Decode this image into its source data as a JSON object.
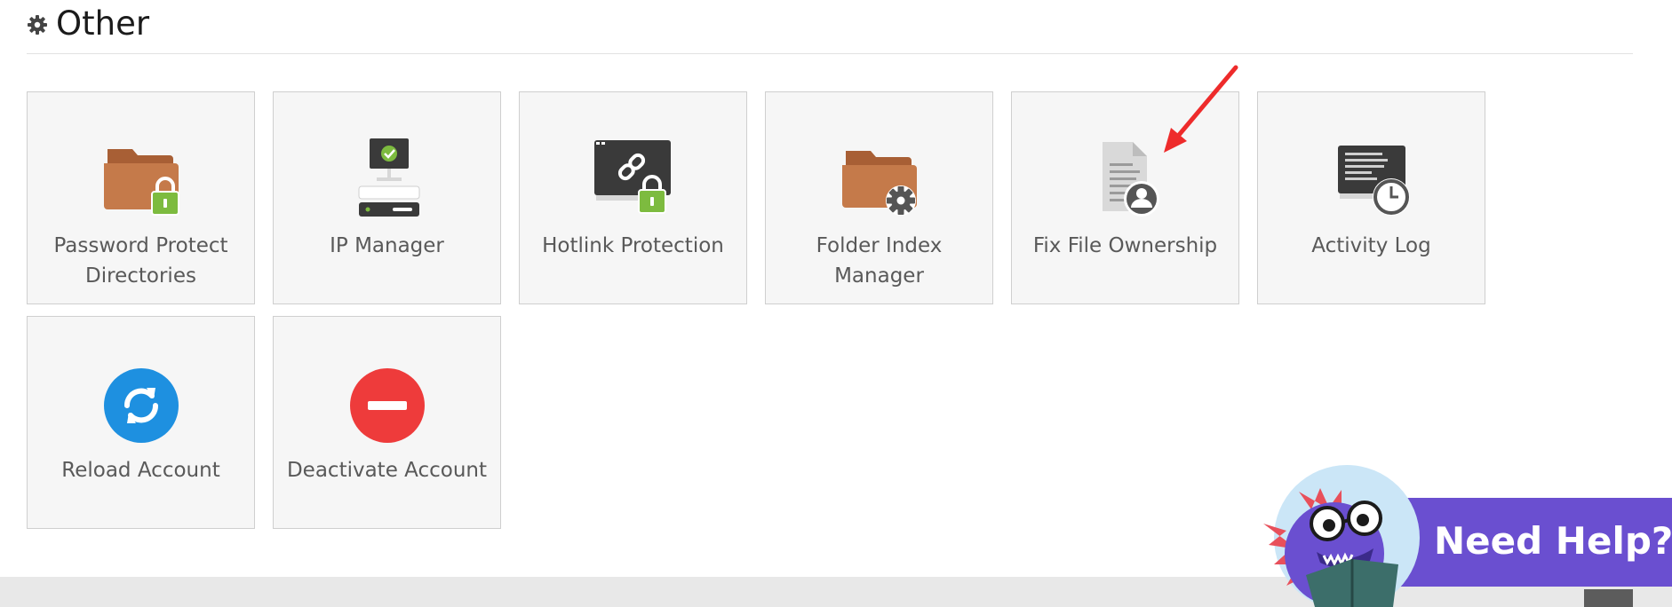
{
  "section": {
    "title": "Other",
    "icon": "gear-icon"
  },
  "tiles": [
    {
      "label": "Password Protect Directories",
      "icon": "folder-lock-icon"
    },
    {
      "label": "IP Manager",
      "icon": "ip-manager-icon"
    },
    {
      "label": "Hotlink Protection",
      "icon": "hotlink-protection-icon"
    },
    {
      "label": "Folder Index Manager",
      "icon": "folder-gear-icon"
    },
    {
      "label": "Fix File Ownership",
      "icon": "file-ownership-icon"
    },
    {
      "label": "Activity Log",
      "icon": "activity-log-icon"
    },
    {
      "label": "Reload Account",
      "icon": "reload-icon"
    },
    {
      "label": "Deactivate Account",
      "icon": "deactivate-icon"
    }
  ],
  "help_widget": {
    "label": "Need Help?",
    "icon": "mascot-icon"
  },
  "colors": {
    "folder": "#c57a4a",
    "lock": "#7dbb3f",
    "reload": "#1e90e0",
    "deactivate": "#ee3b3b",
    "help_bg": "#6a4fd0",
    "annotation_arrow": "#ee2b2b"
  }
}
